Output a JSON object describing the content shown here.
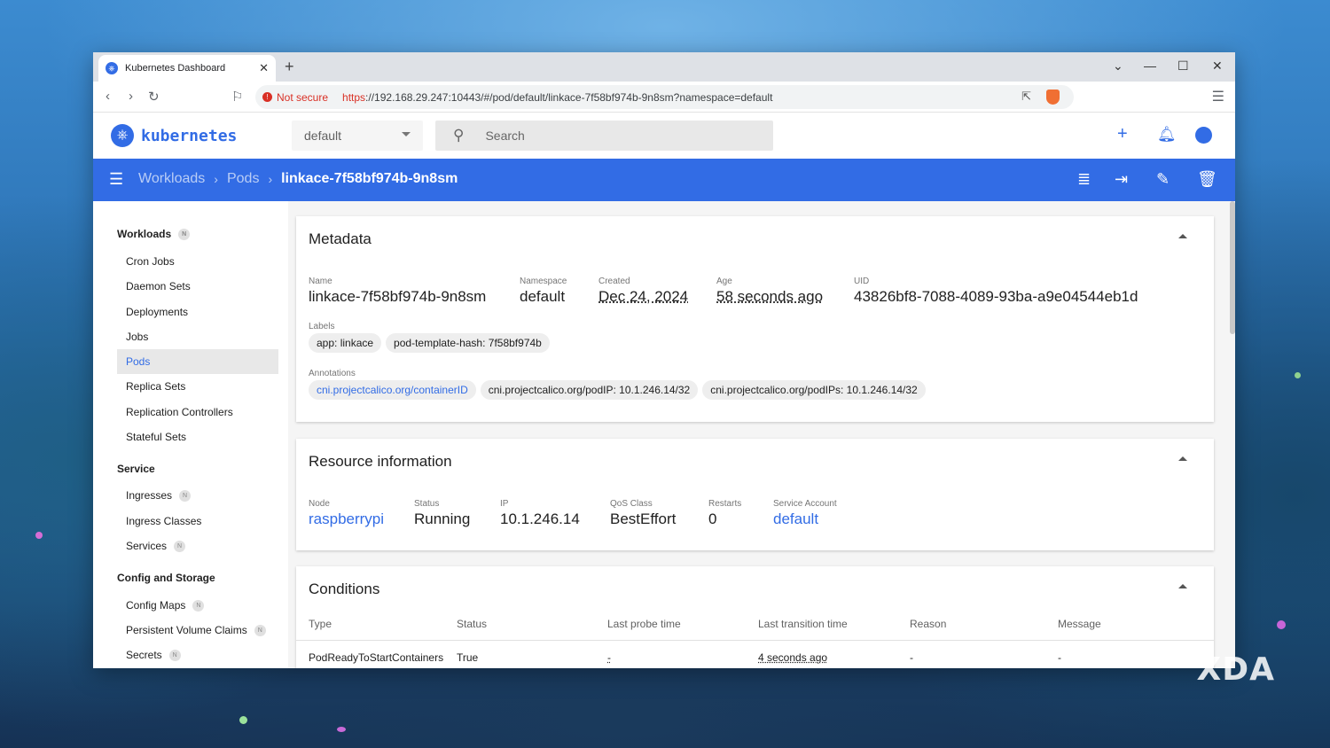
{
  "browser": {
    "tab_title": "Kubernetes Dashboard",
    "new_tab": "+",
    "security_label": "Not secure",
    "url_scheme": "https",
    "url_rest": "://192.168.29.247:10443/#/pod/default/linkace-7f58bf974b-9n8sm?namespace=default"
  },
  "header": {
    "logo_text": "kubernetes",
    "namespace": "default",
    "search_placeholder": "Search"
  },
  "breadcrumb": {
    "items": [
      "Workloads",
      "Pods"
    ],
    "current": "linkace-7f58bf974b-9n8sm"
  },
  "sidebar": {
    "badge": "N",
    "sections": [
      {
        "title": "Workloads",
        "items": [
          "Cron Jobs",
          "Daemon Sets",
          "Deployments",
          "Jobs",
          "Pods",
          "Replica Sets",
          "Replication Controllers",
          "Stateful Sets"
        ]
      },
      {
        "title": "Service",
        "items": [
          "Ingresses",
          "Ingress Classes",
          "Services"
        ]
      },
      {
        "title": "Config and Storage",
        "items": [
          "Config Maps",
          "Persistent Volume Claims",
          "Secrets"
        ]
      }
    ],
    "active_item": "Pods"
  },
  "metadata": {
    "title": "Metadata",
    "name_label": "Name",
    "name": "linkace-7f58bf974b-9n8sm",
    "namespace_label": "Namespace",
    "namespace": "default",
    "created_label": "Created",
    "created": "Dec 24, 2024",
    "age_label": "Age",
    "age": "58 seconds ago",
    "uid_label": "UID",
    "uid": "43826bf8-7088-4089-93ba-a9e04544eb1d",
    "labels_label": "Labels",
    "labels": [
      "app: linkace",
      "pod-template-hash: 7f58bf974b"
    ],
    "annotations_label": "Annotations",
    "annotations": [
      "cni.projectcalico.org/containerID",
      "cni.projectcalico.org/podIP: 10.1.246.14/32",
      "cni.projectcalico.org/podIPs: 10.1.246.14/32"
    ]
  },
  "resource": {
    "title": "Resource information",
    "node_label": "Node",
    "node": "raspberrypi",
    "status_label": "Status",
    "status": "Running",
    "ip_label": "IP",
    "ip": "10.1.246.14",
    "qos_label": "QoS Class",
    "qos": "BestEffort",
    "restarts_label": "Restarts",
    "restarts": "0",
    "sa_label": "Service Account",
    "sa": "default"
  },
  "conditions": {
    "title": "Conditions",
    "columns": [
      "Type",
      "Status",
      "Last probe time",
      "Last transition time",
      "Reason",
      "Message"
    ],
    "rows": [
      [
        "PodReadyToStartContainers",
        "True",
        "-",
        "4 seconds ago",
        "-",
        "-"
      ]
    ]
  },
  "watermark": "XDA",
  "colors": {
    "brand": "#326ce5",
    "danger": "#d93025"
  }
}
